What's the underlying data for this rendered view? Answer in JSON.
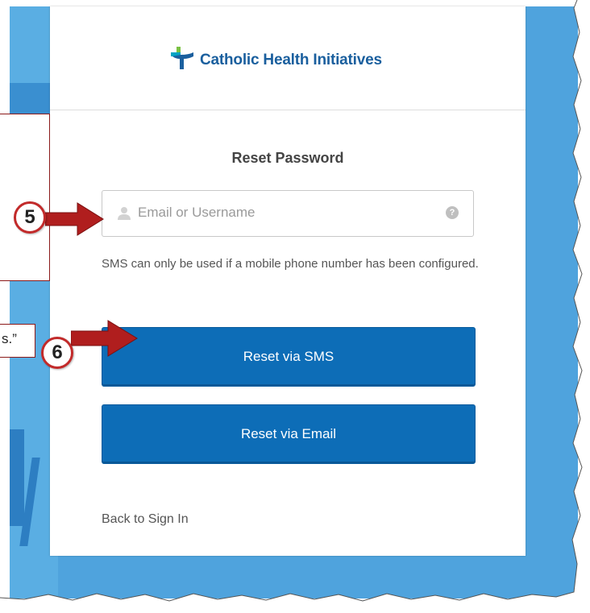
{
  "logo": {
    "text": "Catholic Health Initiatives"
  },
  "form": {
    "title": "Reset Password",
    "email_placeholder": "Email or Username",
    "email_value": "",
    "help_glyph": "?",
    "sms_note": "SMS can only be used if a mobile phone number has been configured.",
    "reset_sms_label": "Reset via SMS",
    "reset_email_label": "Reset via Email",
    "back_link": "Back to Sign In"
  },
  "annotations": {
    "step5": "5",
    "step6": "6",
    "callout2_text": "s.”"
  },
  "colors": {
    "button_blue": "#0d6db7",
    "background_blue": "#4fa3dd",
    "arrow_red": "#b01e1e",
    "logo_blue": "#1a5f9e",
    "logo_green": "#7ac143",
    "logo_teal": "#00a3c4"
  },
  "icons": {
    "input_leading": "user-icon",
    "input_trailing": "help-icon"
  }
}
